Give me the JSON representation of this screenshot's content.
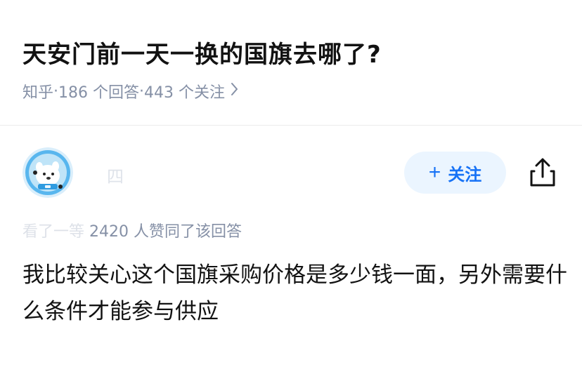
{
  "question": {
    "title": "天安门前一天一换的国旗去哪了?",
    "source": "知乎",
    "sep1": " · ",
    "answers": "186 个回答",
    "sep2": " · ",
    "followers": "443 个关注",
    "chevron_icon": "chevron-right-icon"
  },
  "answer": {
    "author_name_obscured": "四",
    "follow_label": "关注",
    "follow_icon": "plus-icon",
    "share_icon": "share-icon",
    "approval_prefix_obscured": "看了一等",
    "approval_text": " 2420 人赞同了该回答",
    "content": "我比较关心这个国旗采购价格是多少钱一面，另外需要什么条件才能参与供应"
  },
  "colors": {
    "accent": "#1772f6",
    "accent_bg": "#ebf5ff",
    "meta_gray": "#8590a6",
    "text": "#121212"
  }
}
